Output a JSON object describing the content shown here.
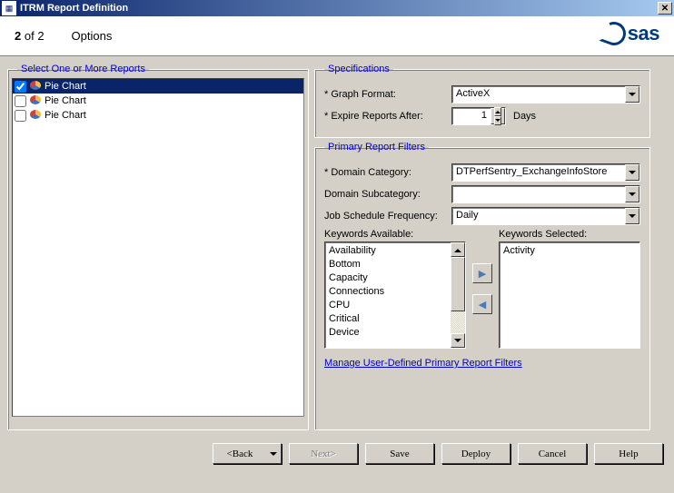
{
  "window": {
    "title": "ITRM Report Definition"
  },
  "header": {
    "step_current": "2",
    "step_total": "of 2",
    "options": "Options",
    "logo_text": "sas"
  },
  "left": {
    "legend": "Select One or More Reports",
    "items": [
      {
        "label": "Pie Chart",
        "checked": true,
        "selected": true
      },
      {
        "label": "Pie Chart",
        "checked": false,
        "selected": false
      },
      {
        "label": "Pie Chart",
        "checked": false,
        "selected": false
      }
    ]
  },
  "spec": {
    "legend": "Specifications",
    "graph_format_label": "* Graph Format:",
    "graph_format_value": "ActiveX",
    "expire_label": "* Expire Reports After:",
    "expire_value": "1",
    "days_label": "Days"
  },
  "filters": {
    "legend": "Primary Report Filters",
    "domain_cat_label": "* Domain Category:",
    "domain_cat_value": "DTPerfSentry_ExchangeInfoStore",
    "domain_sub_label": "Domain Subcategory:",
    "domain_sub_value": "",
    "job_sched_label": "Job Schedule Frequency:",
    "job_sched_value": "Daily",
    "kw_avail_label": "Keywords Available:",
    "kw_sel_label": "Keywords Selected:",
    "kw_available": [
      "Availability",
      "Bottom",
      "Capacity",
      "Connections",
      "CPU",
      "Critical",
      "Device"
    ],
    "kw_selected": [
      "Activity"
    ],
    "manage_link": "Manage User-Defined Primary Report Filters"
  },
  "buttons": {
    "back": "<Back",
    "next": "Next>",
    "save": "Save",
    "deploy": "Deploy",
    "cancel": "Cancel",
    "help": "Help"
  }
}
